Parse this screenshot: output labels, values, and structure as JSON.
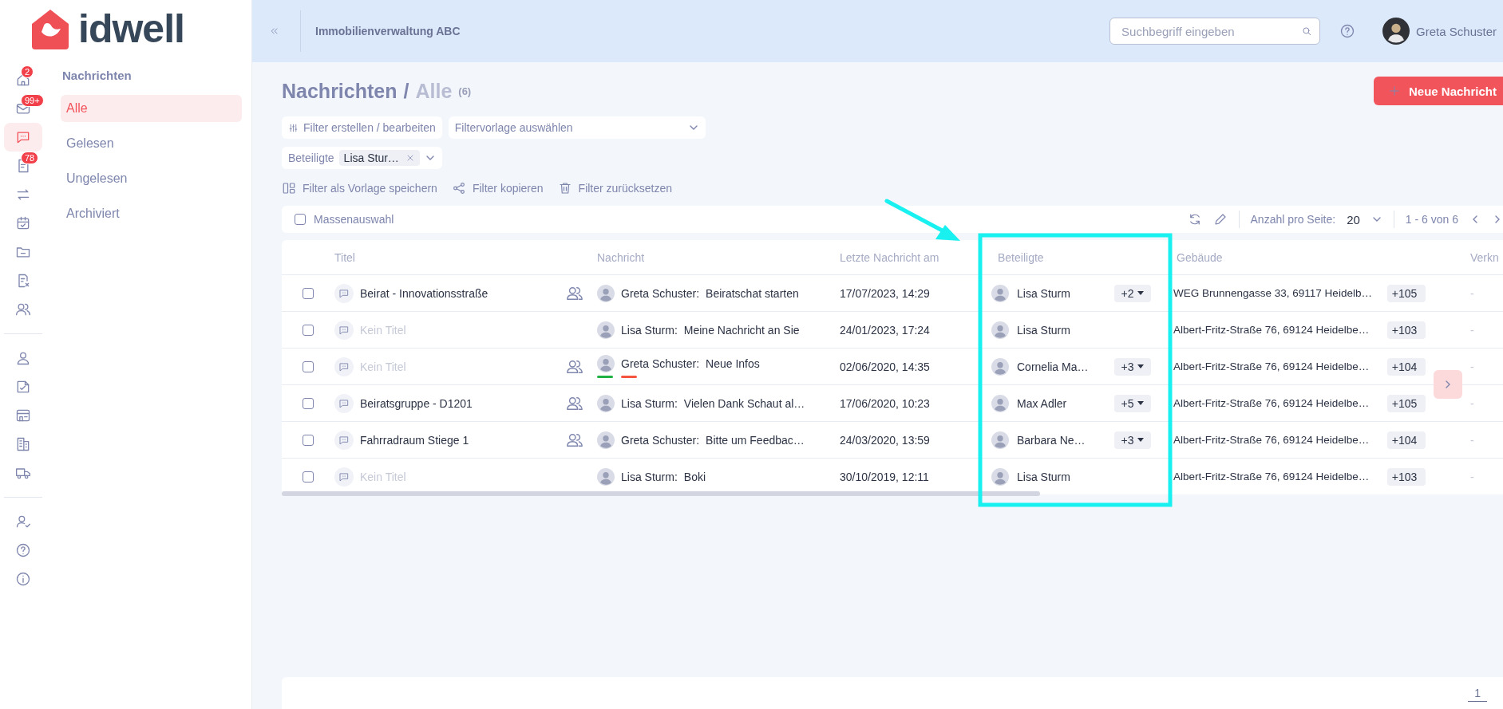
{
  "logo": {
    "text": "idwell"
  },
  "rail": [
    [
      {
        "badge": "2",
        "selected": false
      },
      {
        "badge": "99+",
        "selected": false
      },
      {
        "selected": true
      },
      {
        "badge": "78",
        "selected": false
      },
      {
        "selected": false
      },
      {
        "selected": false
      },
      {
        "selected": false
      },
      {
        "selected": false
      },
      {
        "selected": false
      }
    ],
    [
      {
        "selected": false
      },
      {
        "selected": false
      },
      {
        "selected": false
      },
      {
        "selected": false
      },
      {
        "selected": false
      }
    ],
    [
      {
        "selected": false
      },
      {
        "selected": false
      },
      {
        "selected": false
      }
    ]
  ],
  "submenu": {
    "title": "Nachrichten",
    "items": [
      {
        "label": "Alle",
        "selected": true
      },
      {
        "label": "Gelesen",
        "selected": false
      },
      {
        "label": "Ungelesen",
        "selected": false
      },
      {
        "label": "Archiviert",
        "selected": false
      }
    ]
  },
  "header": {
    "title": "Immobilienverwaltung ABC",
    "search_placeholder": "Suchbegriff eingeben",
    "user": "Greta Schuster"
  },
  "page": {
    "title": "Nachrichten",
    "separator": "/",
    "subtitle": "Alle",
    "count": "(6)",
    "new_button": "Neue Nachricht"
  },
  "filters": {
    "edit": "Filter erstellen / bearbeiten",
    "template_placeholder": "Filtervorlage auswählen",
    "participant_label": "Beteiligte",
    "participant_chip": "Lisa Stur…",
    "actions": [
      "Filter als Vorlage speichern",
      "Filter kopieren",
      "Filter zurücksetzen"
    ]
  },
  "toolbar": {
    "bulk_label": "Massenauswahl",
    "bulk_checked": false,
    "per_page_label": "Anzahl pro Seite:",
    "per_page": "20",
    "range": "1 - 6 von 6"
  },
  "table": {
    "columns": [
      "Titel",
      "Nachricht",
      "Letzte Nachricht am",
      "Beteiligte",
      "Gebäude",
      "Verkn"
    ],
    "rows": [
      {
        "checked": false,
        "title": "Beirat - Innovationsstraße",
        "title_muted": false,
        "group": true,
        "sender": "Greta Schuster:",
        "message": "Beiratschat starten",
        "date": "17/07/2023, 14:29",
        "participant": "Lisa Sturm",
        "participant_more": "+2",
        "building": "WEG Brunnengasse 33, 69117 Heidelb…",
        "building_more": "+105",
        "link": "-"
      },
      {
        "checked": false,
        "title": "Kein Titel",
        "title_muted": true,
        "group": false,
        "sender": "Lisa Sturm:",
        "message": "Meine Nachricht an Sie",
        "date": "24/01/2023, 17:24",
        "participant": "Lisa Sturm",
        "building": "Albert-Fritz-Straße 76, 69124 Heidelbe…",
        "building_more": "+103",
        "link": "-"
      },
      {
        "checked": false,
        "title": "Kein Titel",
        "title_muted": true,
        "group": true,
        "sender": "Greta Schuster:",
        "message": "Neue Infos",
        "read_marks": [
          {
            "color": "#1fb141"
          },
          {
            "color": "#f5553f"
          }
        ],
        "date": "02/06/2020, 14:35",
        "participant": "Cornelia Ma…",
        "participant_more": "+3",
        "building": "Albert-Fritz-Straße 76, 69124 Heidelbe…",
        "building_more": "+104",
        "link": "-"
      },
      {
        "checked": false,
        "title": "Beiratsgruppe - D1201",
        "title_muted": false,
        "group": true,
        "sender": "Lisa Sturm:",
        "message": "Vielen Dank Schaut al…",
        "date": "17/06/2020, 10:23",
        "participant": "Max Adler",
        "participant_more": "+5",
        "building": "Albert-Fritz-Straße 76, 69124 Heidelbe…",
        "building_more": "+105",
        "link": "-"
      },
      {
        "checked": false,
        "title": "Fahrradraum Stiege 1",
        "title_muted": false,
        "group": true,
        "sender": "Greta Schuster:",
        "message": "Bitte um Feedbac…",
        "date": "24/03/2020, 13:59",
        "participant": "Barbara Ne…",
        "participant_more": "+3",
        "building": "Albert-Fritz-Straße 76, 69124 Heidelbe…",
        "building_more": "+104",
        "link": "-"
      },
      {
        "checked": false,
        "title": "Kein Titel",
        "title_muted": true,
        "group": false,
        "sender": "Lisa Sturm:",
        "message": "Boki",
        "date": "30/10/2019, 12:11",
        "participant": "Lisa Sturm",
        "building": "Albert-Fritz-Straße 76, 69124 Heidelbe…",
        "building_more": "+103",
        "link": "-"
      }
    ]
  },
  "pagination": {
    "page": "1"
  }
}
